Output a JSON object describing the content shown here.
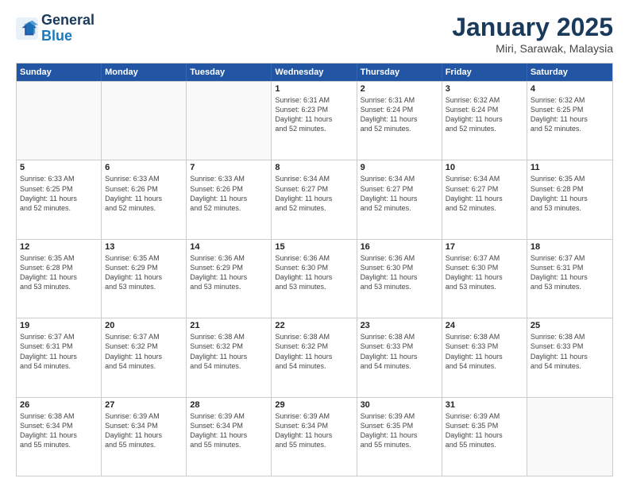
{
  "logo": {
    "line1": "General",
    "line2": "Blue"
  },
  "title": "January 2025",
  "subtitle": "Miri, Sarawak, Malaysia",
  "days_of_week": [
    "Sunday",
    "Monday",
    "Tuesday",
    "Wednesday",
    "Thursday",
    "Friday",
    "Saturday"
  ],
  "weeks": [
    [
      {
        "day": "",
        "info": ""
      },
      {
        "day": "",
        "info": ""
      },
      {
        "day": "",
        "info": ""
      },
      {
        "day": "1",
        "info": "Sunrise: 6:31 AM\nSunset: 6:23 PM\nDaylight: 11 hours\nand 52 minutes."
      },
      {
        "day": "2",
        "info": "Sunrise: 6:31 AM\nSunset: 6:24 PM\nDaylight: 11 hours\nand 52 minutes."
      },
      {
        "day": "3",
        "info": "Sunrise: 6:32 AM\nSunset: 6:24 PM\nDaylight: 11 hours\nand 52 minutes."
      },
      {
        "day": "4",
        "info": "Sunrise: 6:32 AM\nSunset: 6:25 PM\nDaylight: 11 hours\nand 52 minutes."
      }
    ],
    [
      {
        "day": "5",
        "info": "Sunrise: 6:33 AM\nSunset: 6:25 PM\nDaylight: 11 hours\nand 52 minutes."
      },
      {
        "day": "6",
        "info": "Sunrise: 6:33 AM\nSunset: 6:26 PM\nDaylight: 11 hours\nand 52 minutes."
      },
      {
        "day": "7",
        "info": "Sunrise: 6:33 AM\nSunset: 6:26 PM\nDaylight: 11 hours\nand 52 minutes."
      },
      {
        "day": "8",
        "info": "Sunrise: 6:34 AM\nSunset: 6:27 PM\nDaylight: 11 hours\nand 52 minutes."
      },
      {
        "day": "9",
        "info": "Sunrise: 6:34 AM\nSunset: 6:27 PM\nDaylight: 11 hours\nand 52 minutes."
      },
      {
        "day": "10",
        "info": "Sunrise: 6:34 AM\nSunset: 6:27 PM\nDaylight: 11 hours\nand 52 minutes."
      },
      {
        "day": "11",
        "info": "Sunrise: 6:35 AM\nSunset: 6:28 PM\nDaylight: 11 hours\nand 53 minutes."
      }
    ],
    [
      {
        "day": "12",
        "info": "Sunrise: 6:35 AM\nSunset: 6:28 PM\nDaylight: 11 hours\nand 53 minutes."
      },
      {
        "day": "13",
        "info": "Sunrise: 6:35 AM\nSunset: 6:29 PM\nDaylight: 11 hours\nand 53 minutes."
      },
      {
        "day": "14",
        "info": "Sunrise: 6:36 AM\nSunset: 6:29 PM\nDaylight: 11 hours\nand 53 minutes."
      },
      {
        "day": "15",
        "info": "Sunrise: 6:36 AM\nSunset: 6:30 PM\nDaylight: 11 hours\nand 53 minutes."
      },
      {
        "day": "16",
        "info": "Sunrise: 6:36 AM\nSunset: 6:30 PM\nDaylight: 11 hours\nand 53 minutes."
      },
      {
        "day": "17",
        "info": "Sunrise: 6:37 AM\nSunset: 6:30 PM\nDaylight: 11 hours\nand 53 minutes."
      },
      {
        "day": "18",
        "info": "Sunrise: 6:37 AM\nSunset: 6:31 PM\nDaylight: 11 hours\nand 53 minutes."
      }
    ],
    [
      {
        "day": "19",
        "info": "Sunrise: 6:37 AM\nSunset: 6:31 PM\nDaylight: 11 hours\nand 54 minutes."
      },
      {
        "day": "20",
        "info": "Sunrise: 6:37 AM\nSunset: 6:32 PM\nDaylight: 11 hours\nand 54 minutes."
      },
      {
        "day": "21",
        "info": "Sunrise: 6:38 AM\nSunset: 6:32 PM\nDaylight: 11 hours\nand 54 minutes."
      },
      {
        "day": "22",
        "info": "Sunrise: 6:38 AM\nSunset: 6:32 PM\nDaylight: 11 hours\nand 54 minutes."
      },
      {
        "day": "23",
        "info": "Sunrise: 6:38 AM\nSunset: 6:33 PM\nDaylight: 11 hours\nand 54 minutes."
      },
      {
        "day": "24",
        "info": "Sunrise: 6:38 AM\nSunset: 6:33 PM\nDaylight: 11 hours\nand 54 minutes."
      },
      {
        "day": "25",
        "info": "Sunrise: 6:38 AM\nSunset: 6:33 PM\nDaylight: 11 hours\nand 54 minutes."
      }
    ],
    [
      {
        "day": "26",
        "info": "Sunrise: 6:38 AM\nSunset: 6:34 PM\nDaylight: 11 hours\nand 55 minutes."
      },
      {
        "day": "27",
        "info": "Sunrise: 6:39 AM\nSunset: 6:34 PM\nDaylight: 11 hours\nand 55 minutes."
      },
      {
        "day": "28",
        "info": "Sunrise: 6:39 AM\nSunset: 6:34 PM\nDaylight: 11 hours\nand 55 minutes."
      },
      {
        "day": "29",
        "info": "Sunrise: 6:39 AM\nSunset: 6:34 PM\nDaylight: 11 hours\nand 55 minutes."
      },
      {
        "day": "30",
        "info": "Sunrise: 6:39 AM\nSunset: 6:35 PM\nDaylight: 11 hours\nand 55 minutes."
      },
      {
        "day": "31",
        "info": "Sunrise: 6:39 AM\nSunset: 6:35 PM\nDaylight: 11 hours\nand 55 minutes."
      },
      {
        "day": "",
        "info": ""
      }
    ]
  ]
}
